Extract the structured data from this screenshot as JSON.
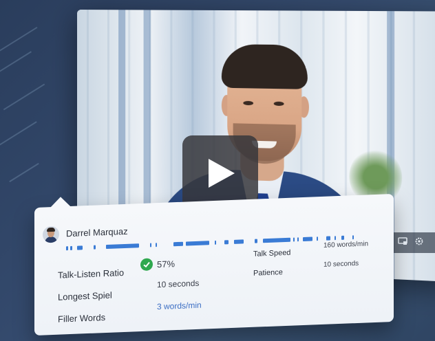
{
  "video": {
    "play_icon": "play-icon",
    "controls": [
      "screen-icon",
      "gear-icon"
    ]
  },
  "speaker": {
    "name": "Darrel Marquaz",
    "avatar_icon": "avatar"
  },
  "timeline_color": "#3a7bd5",
  "stats": {
    "talk_listen_label": "Talk-Listen Ratio",
    "talk_listen_value": "57%",
    "longest_spiel_label": "Longest Spiel",
    "longest_spiel_value": "10 seconds",
    "filler_words_label": "Filler Words",
    "filler_words_value": "3 words/min",
    "talk_speed_label": "Talk Speed",
    "talk_speed_value": "160 words/min",
    "patience_label": "Patience",
    "patience_value": "10 seconds"
  },
  "colors": {
    "check": "#2fa84f",
    "link": "#3d6fc4"
  }
}
